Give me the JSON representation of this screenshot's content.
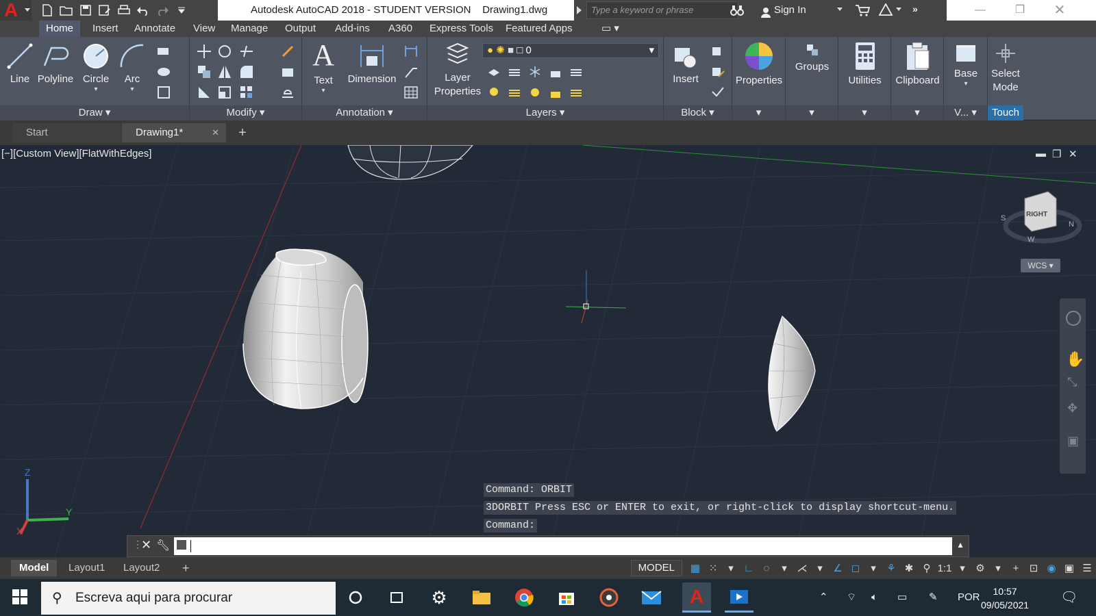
{
  "titlebar": {
    "app_title": "Autodesk AutoCAD 2018 - STUDENT VERSION    Drawing1.dwg",
    "search_placeholder": "Type a keyword or phrase",
    "sign_in": "Sign In"
  },
  "ribbon_tabs": [
    "Home",
    "Insert",
    "Annotate",
    "View",
    "Manage",
    "Output",
    "Add-ins",
    "A360",
    "Express Tools",
    "Featured Apps"
  ],
  "ribbon": {
    "draw": {
      "label": "Draw",
      "line": "Line",
      "polyline": "Polyline",
      "circle": "Circle",
      "arc": "Arc"
    },
    "modify": {
      "label": "Modify"
    },
    "annotation": {
      "label": "Annotation",
      "text": "Text",
      "dimension": "Dimension"
    },
    "layers": {
      "label": "Layers",
      "layer_properties_1": "Layer",
      "layer_properties_2": "Properties",
      "current_layer": "0"
    },
    "block": {
      "label": "Block",
      "insert": "Insert"
    },
    "properties": "Properties",
    "groups": "Groups",
    "utilities": "Utilities",
    "clipboard": "Clipboard",
    "base": "Base",
    "view_short": "V...",
    "select_mode_1": "Select",
    "select_mode_2": "Mode",
    "touch": "Touch"
  },
  "file_tabs": {
    "start": "Start",
    "drawing": "Drawing1*"
  },
  "viewport": {
    "label": "[−][Custom View][FlatWithEdges]",
    "viewcube_face": "RIGHT",
    "wcs": "WCS",
    "axis_x": "X",
    "axis_y": "Y",
    "axis_z": "Z"
  },
  "command": {
    "history": [
      "Command: ORBIT",
      "3DORBIT Press ESC or ENTER to exit, or right-click to display shortcut-menu.",
      "Command:"
    ]
  },
  "layout_tabs": [
    "Model",
    "Layout1",
    "Layout2"
  ],
  "statusbar": {
    "model": "MODEL",
    "scale": "1:1"
  },
  "taskbar": {
    "search_placeholder": "Escreva aqui para procurar",
    "language": "POR",
    "time": "10:57",
    "date": "09/05/2021"
  },
  "colors": {
    "autocad_red": "#e2231a",
    "viewport_bg": "#222a37",
    "ribbon_bg": "#4f5561",
    "accent_blue": "#2a6fa8"
  }
}
